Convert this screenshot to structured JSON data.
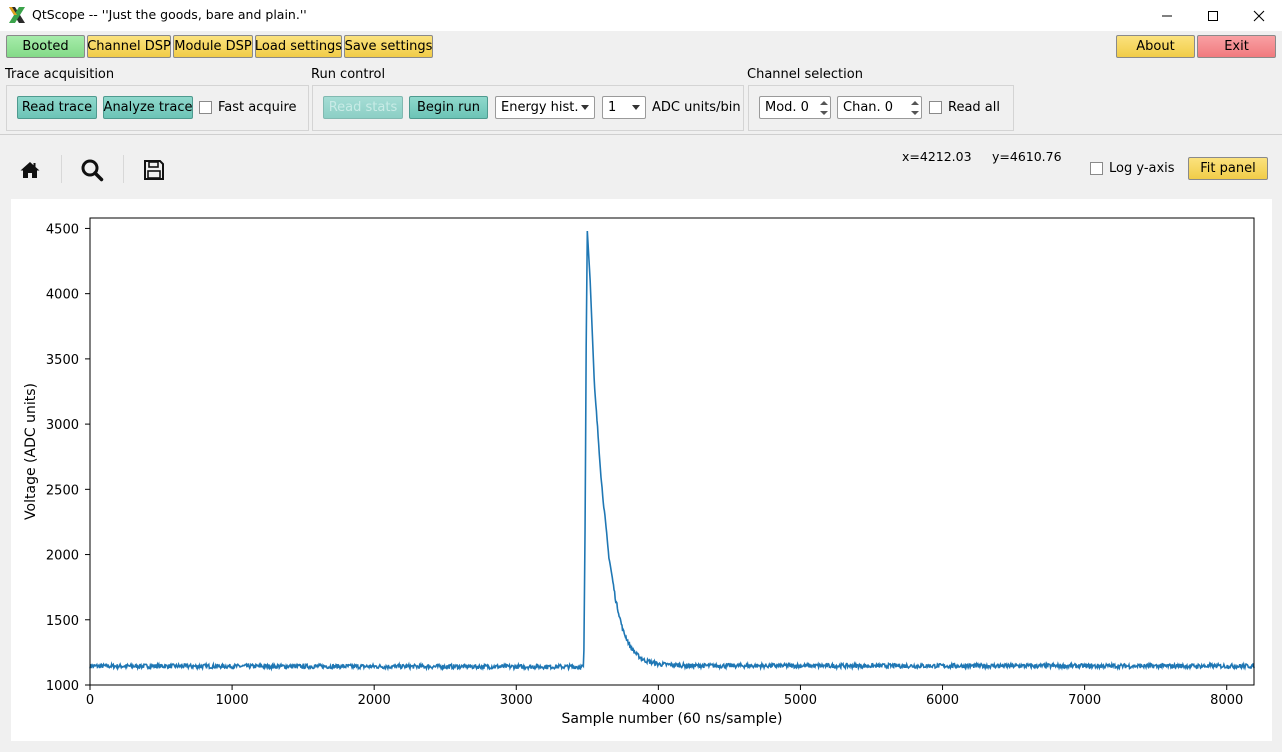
{
  "window": {
    "title": "QtScope -- ''Just the goods, bare and plain.''"
  },
  "topbar": {
    "booted": "Booted",
    "channel_dsp": "Channel DSP",
    "module_dsp": "Module DSP",
    "load_settings": "Load settings",
    "save_settings": "Save settings",
    "about": "About",
    "exit": "Exit"
  },
  "trace_acq": {
    "label": "Trace acquisition",
    "read_trace": "Read trace",
    "analyze_trace": "Analyze trace",
    "fast_acquire": "Fast acquire"
  },
  "run_control": {
    "label": "Run control",
    "disabled_btn": "Read stats",
    "begin_run": "Begin run",
    "mode_value": "Energy hist.",
    "bin_value": "1",
    "bin_unit": "ADC units/bin"
  },
  "chan_sel": {
    "label": "Channel selection",
    "mod_value": "Mod. 0",
    "chan_value": "Chan. 0",
    "read_all": "Read all"
  },
  "plot_toolbar": {
    "icons": [
      "home-icon",
      "zoom-icon",
      "save-icon"
    ],
    "x_readout": "x=4212.03",
    "y_readout": "y=4610.76",
    "log_y": "Log y-axis",
    "fit_panel": "Fit panel"
  },
  "chart_data": {
    "type": "line",
    "title": "",
    "xlabel": "Sample number (60 ns/sample)",
    "ylabel": "Voltage (ADC units)",
    "xlim": [
      0,
      8192
    ],
    "ylim": [
      1000,
      4580
    ],
    "xticks": [
      0,
      1000,
      2000,
      3000,
      4000,
      5000,
      6000,
      7000,
      8000
    ],
    "yticks": [
      1000,
      1500,
      2000,
      2500,
      3000,
      3500,
      4000,
      4500
    ],
    "grid": false,
    "color": "#1f77b4",
    "series": [
      {
        "baseline": 1145,
        "pulse_start": 3480,
        "peak_x": 3500,
        "peak_y": 4480,
        "points": [
          [
            0,
            1145
          ],
          [
            3475,
            1140
          ],
          [
            3485,
            2300
          ],
          [
            3492,
            3600
          ],
          [
            3500,
            4480
          ],
          [
            3520,
            4100
          ],
          [
            3550,
            3300
          ],
          [
            3600,
            2550
          ],
          [
            3650,
            2000
          ],
          [
            3700,
            1650
          ],
          [
            3750,
            1420
          ],
          [
            3800,
            1300
          ],
          [
            3850,
            1230
          ],
          [
            3900,
            1190
          ],
          [
            4000,
            1160
          ],
          [
            4200,
            1148
          ],
          [
            8192,
            1145
          ]
        ]
      }
    ]
  }
}
